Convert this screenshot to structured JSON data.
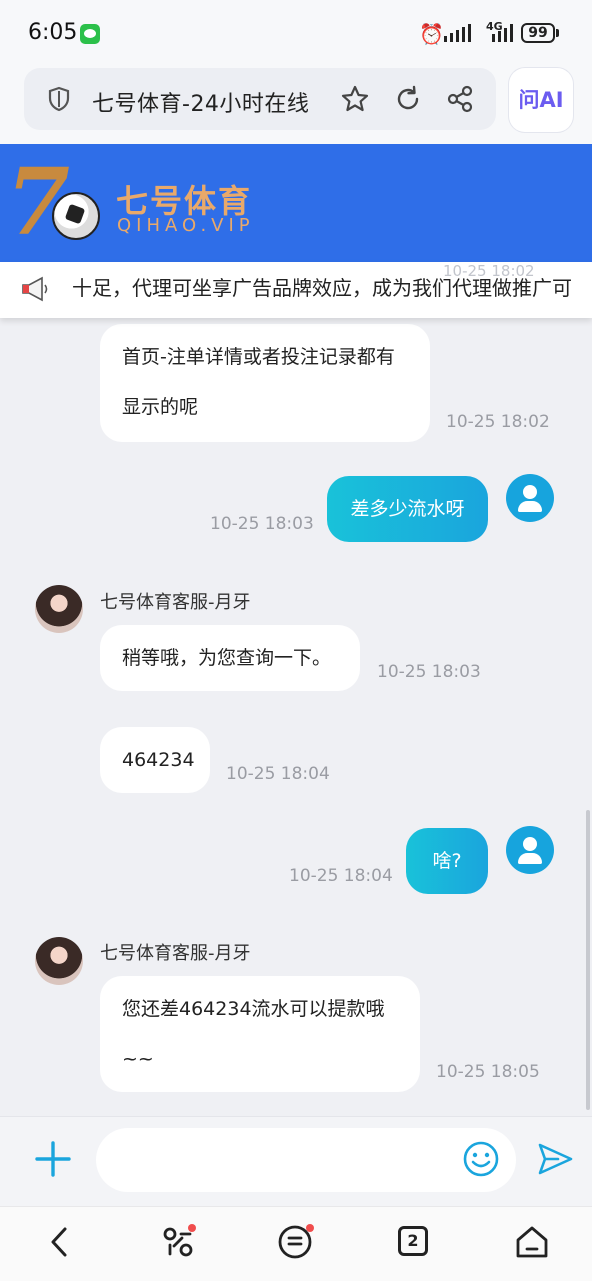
{
  "status_bar": {
    "time": "6:05",
    "network": "4G",
    "battery": "99"
  },
  "browser": {
    "page_title": "七号体育-24小时在线",
    "ai_button": "问AI"
  },
  "site": {
    "brand_digit": "7",
    "brand_name": "七号体育",
    "brand_domain": "QIHAO.VIP"
  },
  "marquee": {
    "text": "十足，代理可坐享广告品牌效应，成为我们代理做推广可",
    "hidden_timestamp": "10-25 18:02"
  },
  "messages": [
    {
      "type": "agent",
      "text_line1": "首页-注单详情或者投注记录都有",
      "text_line2": "显示的呢",
      "time": "10-25 18:02"
    },
    {
      "type": "self",
      "text": "差多少流水呀",
      "time": "10-25 18:03"
    },
    {
      "type": "agent",
      "name": "七号体育客服-月牙",
      "text": "稍等哦，为您查询一下。",
      "time": "10-25 18:03"
    },
    {
      "type": "agent",
      "text": "464234",
      "time": "10-25 18:04"
    },
    {
      "type": "self",
      "text": "啥?",
      "time": "10-25 18:04"
    },
    {
      "type": "agent",
      "name": "七号体育客服-月牙",
      "text_line1": "您还差464234流水可以提款哦",
      "text_line2": "~~",
      "time": "10-25 18:05"
    }
  ],
  "input": {
    "placeholder": ""
  },
  "bottom_nav": {
    "tab_count": "2"
  },
  "colors": {
    "header_blue": "#2f6ee8",
    "brand_gold": "#e9a96a",
    "self_bubble": "#19c2d9",
    "accent": "#1aa5dd"
  }
}
